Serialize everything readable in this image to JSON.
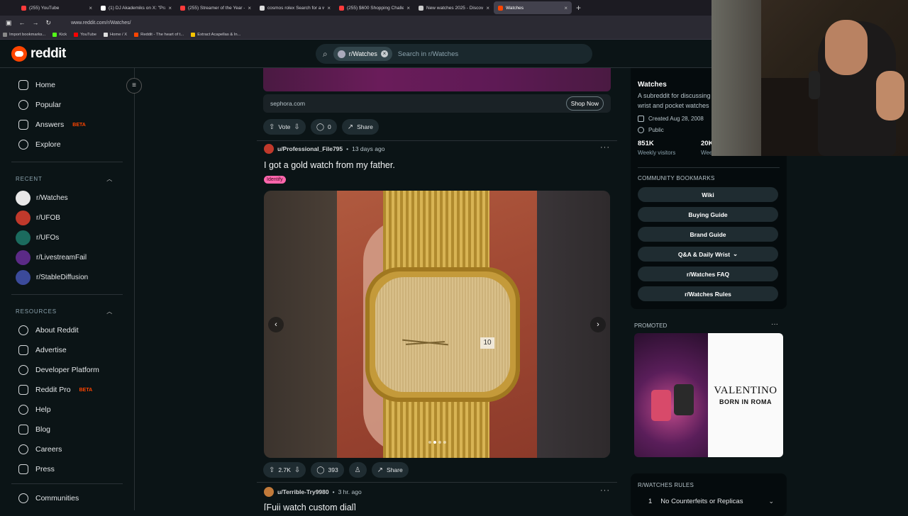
{
  "browser": {
    "tabs": [
      {
        "title": "(255) YouTube",
        "color": "#ff3b3b"
      },
      {
        "title": "(1) DJ Akademiks on X: \"Pray fo",
        "color": "#ffffff"
      },
      {
        "title": "(255) Streamer of the Year - You",
        "color": "#ff3b3b"
      },
      {
        "title": "cosmos rolex Search for a wrist",
        "color": "#dddddd"
      },
      {
        "title": "(255) $600 Shopping Challenge",
        "color": "#ff3b3b"
      },
      {
        "title": "New watches 2025 - Discover th",
        "color": "#cccccc"
      },
      {
        "title": "Watches",
        "color": "#ff4500",
        "active": true
      }
    ],
    "url": "www.reddit.com/r/Watches/",
    "bookmarks": [
      {
        "label": "Import bookmarks...",
        "color": "#888888"
      },
      {
        "label": "Kick",
        "color": "#53fc18"
      },
      {
        "label": "YouTube",
        "color": "#ff0000"
      },
      {
        "label": "Home / X",
        "color": "#dddddd"
      },
      {
        "label": "Reddit - The heart of t...",
        "color": "#ff4500"
      },
      {
        "label": "Extract Acapellas & In...",
        "color": "#f5c400"
      }
    ]
  },
  "header": {
    "logo_text": "reddit",
    "search_chip": "r/Watches",
    "search_placeholder": "Search in r/Watches"
  },
  "leftnav": {
    "main": [
      {
        "label": "Home",
        "icon": "home-icon"
      },
      {
        "label": "Popular",
        "icon": "popular-icon"
      },
      {
        "label": "Answers",
        "icon": "answers-icon",
        "badge": "BETA"
      },
      {
        "label": "Explore",
        "icon": "explore-icon"
      }
    ],
    "recent_heading": "RECENT",
    "recent": [
      {
        "label": "r/Watches",
        "color": "#e8e8e8"
      },
      {
        "label": "r/UFOB",
        "color": "#c0392b"
      },
      {
        "label": "r/UFOs",
        "color": "#1b6b5e"
      },
      {
        "label": "r/LivestreamFail",
        "color": "#5b2a86"
      },
      {
        "label": "r/StableDiffusion",
        "color": "#3b4a9a"
      }
    ],
    "resources_heading": "RESOURCES",
    "resources": [
      {
        "label": "About Reddit"
      },
      {
        "label": "Advertise"
      },
      {
        "label": "Developer Platform"
      },
      {
        "label": "Reddit Pro",
        "badge": "BETA"
      },
      {
        "label": "Help"
      },
      {
        "label": "Blog"
      },
      {
        "label": "Careers"
      },
      {
        "label": "Press"
      }
    ],
    "communities": "Communities"
  },
  "feed": {
    "ad": {
      "domain": "sephora.com",
      "cta": "Shop Now",
      "vote_label": "Vote",
      "comments": "0",
      "share": "Share"
    },
    "post": {
      "user": "u/Professional_File795",
      "age": "13 days ago",
      "title": "I got a gold watch from my father.",
      "flair": "Identify",
      "date_window": "10",
      "votes": "2.7K",
      "comments": "393",
      "share": "Share",
      "slides": 4,
      "current_slide": 2
    },
    "next_post": {
      "user": "u/Terrible-Try9980",
      "age": "3 hr. ago",
      "title": "[Fuji watch custom dial]"
    }
  },
  "sidebar": {
    "name": "Watches",
    "description": "A subreddit for discussing wrist and pocket watches",
    "created": "Created Aug 28, 2008",
    "visibility": "Public",
    "visitors": "851K",
    "visitors_label": "Weekly visitors",
    "contrib": "20K",
    "contrib_label": "Weekly contributions",
    "bookmarks_heading": "COMMUNITY BOOKMARKS",
    "bookmarks": [
      "Wiki",
      "Buying Guide",
      "Brand Guide",
      "Q&A & Daily Wrist",
      "r/Watches FAQ",
      "r/Watches Rules"
    ],
    "promoted_label": "PROMOTED",
    "promo_brand": "VALENTINO",
    "promo_tagline": "BORN IN ROMA",
    "rules_heading": "R/WATCHES RULES",
    "rule1_num": "1",
    "rule1": "No Counterfeits or Replicas"
  }
}
